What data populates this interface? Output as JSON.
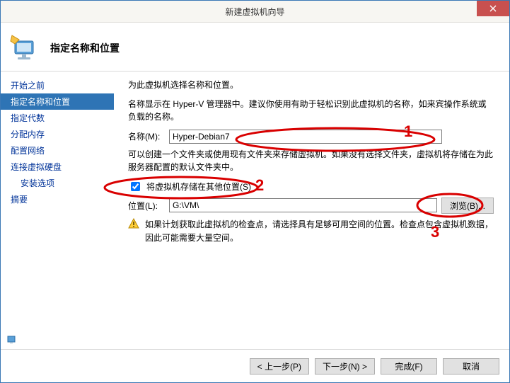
{
  "window": {
    "title": "新建虚拟机向导"
  },
  "header": {
    "heading": "指定名称和位置"
  },
  "sidebar": {
    "items": [
      {
        "label": "开始之前",
        "selected": false
      },
      {
        "label": "指定名称和位置",
        "selected": true
      },
      {
        "label": "指定代数",
        "selected": false
      },
      {
        "label": "分配内存",
        "selected": false
      },
      {
        "label": "配置网络",
        "selected": false
      },
      {
        "label": "连接虚拟硬盘",
        "selected": false
      },
      {
        "label": "安装选项",
        "selected": false,
        "indent": true
      },
      {
        "label": "摘要",
        "selected": false
      }
    ]
  },
  "main": {
    "intro": "为此虚拟机选择名称和位置。",
    "desc1": "名称显示在 Hyper-V 管理器中。建议你使用有助于轻松识别此虚拟机的名称，如来宾操作系统或负载的名称。",
    "name_label": "名称(M):",
    "name_value": "Hyper-Debian7",
    "desc2": "可以创建一个文件夹或使用现有文件夹来存储虚拟机。如果没有选择文件夹，虚拟机将存储在为此服务器配置的默认文件夹中。",
    "store_checkbox_label": "将虚拟机存储在其他位置(S)",
    "store_checked": true,
    "location_label": "位置(L):",
    "location_value": "G:\\VM\\",
    "browse_label": "浏览(B)...",
    "warn_text": "如果计划获取此虚拟机的检查点，请选择具有足够可用空间的位置。检查点包含虚拟机数据，因此可能需要大量空间。"
  },
  "footer": {
    "prev": "< 上一步(P)",
    "next": "下一步(N) >",
    "finish": "完成(F)",
    "cancel": "取消"
  },
  "annotations": {
    "n1": "1",
    "n2": "2",
    "n3": "3"
  }
}
